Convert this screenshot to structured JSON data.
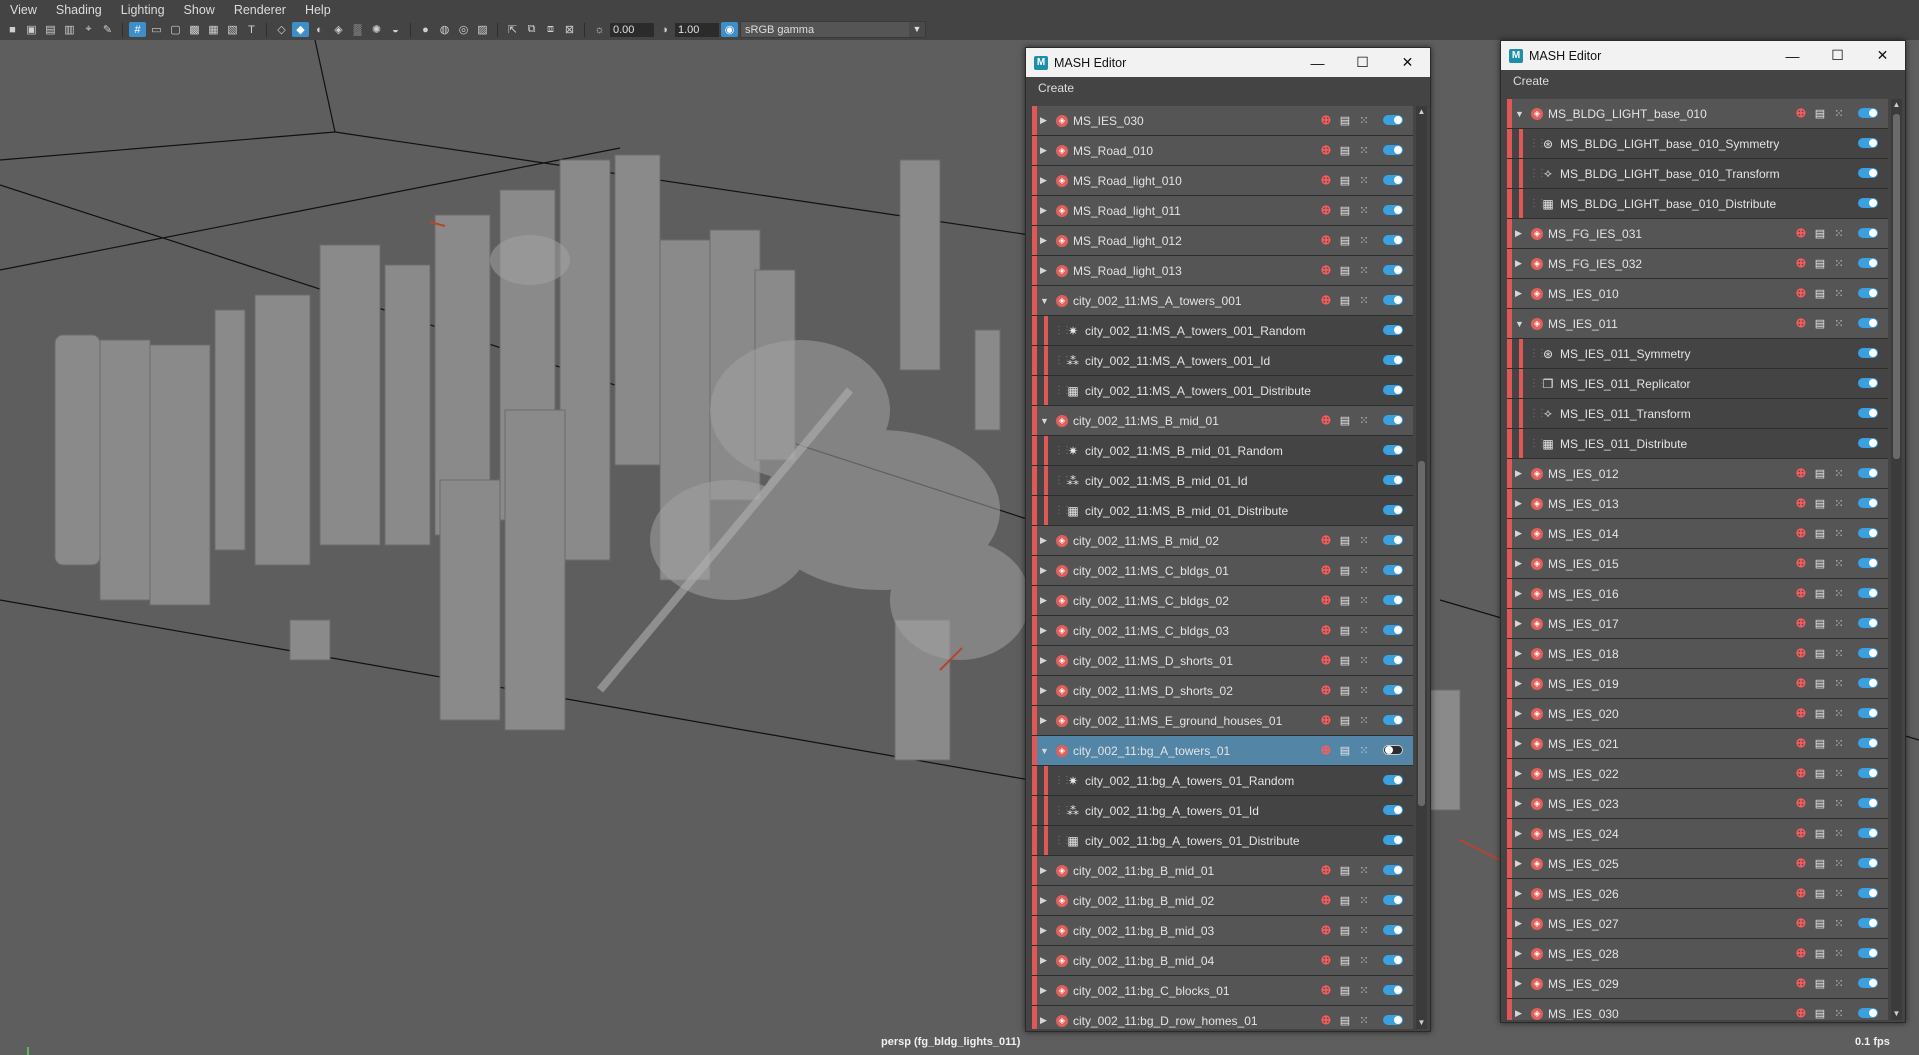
{
  "menubar": {
    "items": [
      "View",
      "Shading",
      "Lighting",
      "Show",
      "Renderer",
      "Help"
    ]
  },
  "toolbar": {
    "exposure_value": "0.00",
    "gamma_value": "1.00",
    "color_space": "sRGB gamma"
  },
  "viewport": {
    "camera_label": "persp (fg_bldg_lights_011)",
    "fps_label": "0.1 fps"
  },
  "colors": {
    "accent_blue": "#3aa0e0",
    "selection": "#5285a6",
    "mash_red": "#e05757"
  },
  "editor_left": {
    "title": "MASH Editor",
    "create_label": "Create",
    "rows": [
      {
        "label": "MS_IES_030",
        "kind": "network",
        "expanded": false
      },
      {
        "label": "MS_Road_010",
        "kind": "network",
        "expanded": false
      },
      {
        "label": "MS_Road_light_010",
        "kind": "network",
        "expanded": false
      },
      {
        "label": "MS_Road_light_011",
        "kind": "network",
        "expanded": false
      },
      {
        "label": "MS_Road_light_012",
        "kind": "network",
        "expanded": false
      },
      {
        "label": "MS_Road_light_013",
        "kind": "network",
        "expanded": false
      },
      {
        "label": "city_002_11:MS_A_towers_001",
        "kind": "network",
        "expanded": true
      },
      {
        "label": "city_002_11:MS_A_towers_001_Random",
        "kind": "child",
        "icon": "random-icon"
      },
      {
        "label": "city_002_11:MS_A_towers_001_Id",
        "kind": "child",
        "icon": "id-icon"
      },
      {
        "label": "city_002_11:MS_A_towers_001_Distribute",
        "kind": "child",
        "icon": "distribute-icon"
      },
      {
        "label": "city_002_11:MS_B_mid_01",
        "kind": "network",
        "expanded": true
      },
      {
        "label": "city_002_11:MS_B_mid_01_Random",
        "kind": "child",
        "icon": "random-icon"
      },
      {
        "label": "city_002_11:MS_B_mid_01_Id",
        "kind": "child",
        "icon": "id-icon"
      },
      {
        "label": "city_002_11:MS_B_mid_01_Distribute",
        "kind": "child",
        "icon": "distribute-icon"
      },
      {
        "label": "city_002_11:MS_B_mid_02",
        "kind": "network",
        "expanded": false
      },
      {
        "label": "city_002_11:MS_C_bldgs_01",
        "kind": "network",
        "expanded": false
      },
      {
        "label": "city_002_11:MS_C_bldgs_02",
        "kind": "network",
        "expanded": false
      },
      {
        "label": "city_002_11:MS_C_bldgs_03",
        "kind": "network",
        "expanded": false
      },
      {
        "label": "city_002_11:MS_D_shorts_01",
        "kind": "network",
        "expanded": false
      },
      {
        "label": "city_002_11:MS_D_shorts_02",
        "kind": "network",
        "expanded": false
      },
      {
        "label": "city_002_11:MS_E_ground_houses_01",
        "kind": "network",
        "expanded": false
      },
      {
        "label": "city_002_11:bg_A_towers_01",
        "kind": "network",
        "expanded": true,
        "selected": true,
        "toggle_off": true
      },
      {
        "label": "city_002_11:bg_A_towers_01_Random",
        "kind": "child",
        "icon": "random-icon"
      },
      {
        "label": "city_002_11:bg_A_towers_01_Id",
        "kind": "child",
        "icon": "id-icon"
      },
      {
        "label": "city_002_11:bg_A_towers_01_Distribute",
        "kind": "child",
        "icon": "distribute-icon"
      },
      {
        "label": "city_002_11:bg_B_mid_01",
        "kind": "network",
        "expanded": false
      },
      {
        "label": "city_002_11:bg_B_mid_02",
        "kind": "network",
        "expanded": false
      },
      {
        "label": "city_002_11:bg_B_mid_03",
        "kind": "network",
        "expanded": false
      },
      {
        "label": "city_002_11:bg_B_mid_04",
        "kind": "network",
        "expanded": false
      },
      {
        "label": "city_002_11:bg_C_blocks_01",
        "kind": "network",
        "expanded": false
      },
      {
        "label": "city_002_11:bg_D_row_homes_01",
        "kind": "network",
        "expanded": false
      }
    ]
  },
  "editor_right": {
    "title": "MASH Editor",
    "create_label": "Create",
    "rows": [
      {
        "label": "MS_BLDG_LIGHT_base_010",
        "kind": "network",
        "expanded": true
      },
      {
        "label": "MS_BLDG_LIGHT_base_010_Symmetry",
        "kind": "child",
        "icon": "symmetry-icon"
      },
      {
        "label": "MS_BLDG_LIGHT_base_010_Transform",
        "kind": "child",
        "icon": "transform-icon"
      },
      {
        "label": "MS_BLDG_LIGHT_base_010_Distribute",
        "kind": "child",
        "icon": "distribute-icon"
      },
      {
        "label": "MS_FG_IES_031",
        "kind": "network",
        "expanded": false
      },
      {
        "label": "MS_FG_IES_032",
        "kind": "network",
        "expanded": false
      },
      {
        "label": "MS_IES_010",
        "kind": "network",
        "expanded": false
      },
      {
        "label": "MS_IES_011",
        "kind": "network",
        "expanded": true
      },
      {
        "label": "MS_IES_011_Symmetry",
        "kind": "child",
        "icon": "symmetry-icon"
      },
      {
        "label": "MS_IES_011_Replicator",
        "kind": "child",
        "icon": "replicator-icon"
      },
      {
        "label": "MS_IES_011_Transform",
        "kind": "child",
        "icon": "transform-icon"
      },
      {
        "label": "MS_IES_011_Distribute",
        "kind": "child",
        "icon": "distribute-icon"
      },
      {
        "label": "MS_IES_012",
        "kind": "network",
        "expanded": false
      },
      {
        "label": "MS_IES_013",
        "kind": "network",
        "expanded": false
      },
      {
        "label": "MS_IES_014",
        "kind": "network",
        "expanded": false
      },
      {
        "label": "MS_IES_015",
        "kind": "network",
        "expanded": false
      },
      {
        "label": "MS_IES_016",
        "kind": "network",
        "expanded": false
      },
      {
        "label": "MS_IES_017",
        "kind": "network",
        "expanded": false
      },
      {
        "label": "MS_IES_018",
        "kind": "network",
        "expanded": false
      },
      {
        "label": "MS_IES_019",
        "kind": "network",
        "expanded": false
      },
      {
        "label": "MS_IES_020",
        "kind": "network",
        "expanded": false
      },
      {
        "label": "MS_IES_021",
        "kind": "network",
        "expanded": false
      },
      {
        "label": "MS_IES_022",
        "kind": "network",
        "expanded": false
      },
      {
        "label": "MS_IES_023",
        "kind": "network",
        "expanded": false
      },
      {
        "label": "MS_IES_024",
        "kind": "network",
        "expanded": false
      },
      {
        "label": "MS_IES_025",
        "kind": "network",
        "expanded": false
      },
      {
        "label": "MS_IES_026",
        "kind": "network",
        "expanded": false
      },
      {
        "label": "MS_IES_027",
        "kind": "network",
        "expanded": false
      },
      {
        "label": "MS_IES_028",
        "kind": "network",
        "expanded": false
      },
      {
        "label": "MS_IES_029",
        "kind": "network",
        "expanded": false
      },
      {
        "label": "MS_IES_030",
        "kind": "network",
        "expanded": false
      }
    ]
  }
}
